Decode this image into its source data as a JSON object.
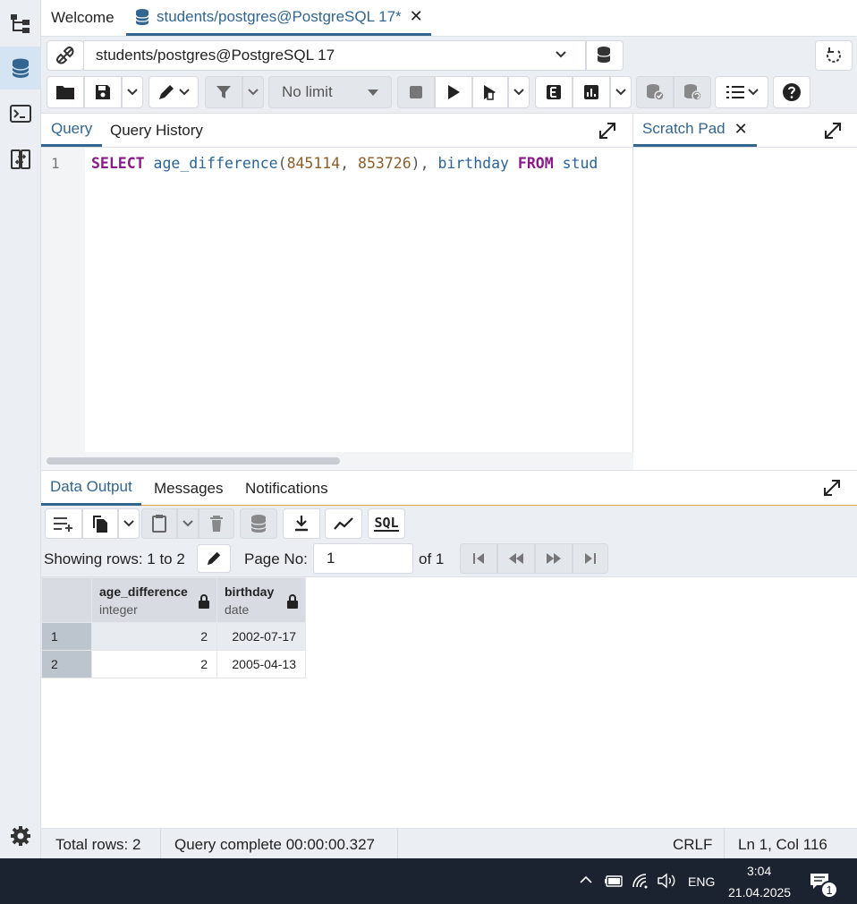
{
  "tabs": {
    "welcome": "Welcome",
    "active": "students/postgres@PostgreSQL 17*"
  },
  "toolbar": {
    "connection": "students/postgres@PostgreSQL 17",
    "limit": "No limit"
  },
  "query_panel": {
    "tab_query": "Query",
    "tab_history": "Query History",
    "line_number": "1",
    "code": {
      "kw_select": "SELECT",
      "fn": "age_difference",
      "open": "(",
      "arg1": "845114",
      "comma": ", ",
      "arg2": "853726",
      "close": "), ",
      "col": "birthday",
      "kw_from": "FROM",
      "rest": "stud"
    }
  },
  "scratch": {
    "title": "Scratch Pad"
  },
  "output": {
    "tab_data": "Data Output",
    "tab_messages": "Messages",
    "tab_notifications": "Notifications",
    "showing_rows": "Showing rows: 1 to 2",
    "page_no_label": "Page No:",
    "page_no": "1",
    "of_pages": "of 1",
    "sql_label": "SQL",
    "columns": [
      {
        "name": "age_difference",
        "type": "integer"
      },
      {
        "name": "birthday",
        "type": "date"
      }
    ],
    "rows": [
      {
        "n": "1",
        "age_difference": "2",
        "birthday": "2002-07-17"
      },
      {
        "n": "2",
        "age_difference": "2",
        "birthday": "2005-04-13"
      }
    ]
  },
  "status": {
    "total_rows": "Total rows: 2",
    "query_complete": "Query complete 00:00:00.327",
    "eol": "CRLF",
    "cursor": "Ln 1, Col 116"
  },
  "taskbar": {
    "lang": "ENG",
    "time": "3:04",
    "date": "21.04.2025",
    "notif_count": "1"
  }
}
